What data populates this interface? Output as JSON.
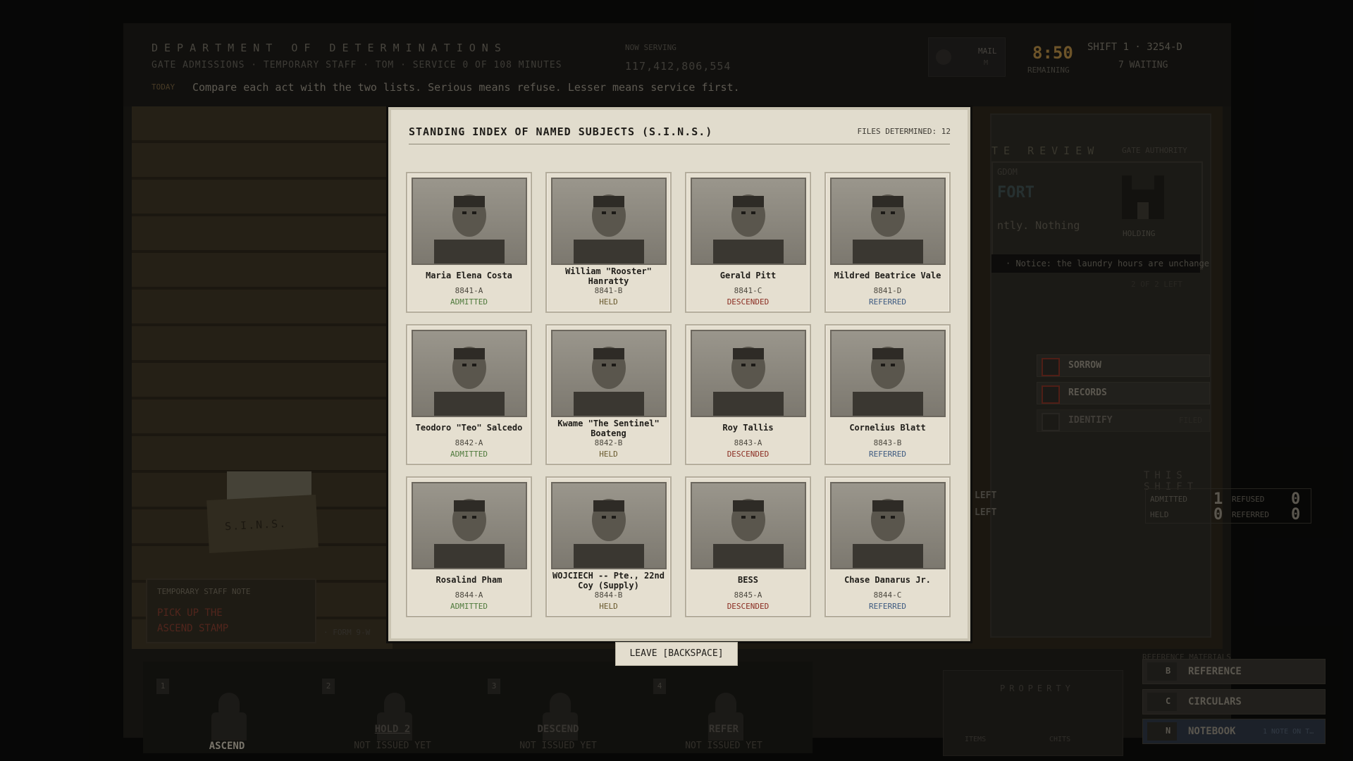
{
  "header": {
    "department": "DEPARTMENT OF DETERMINATIONS",
    "subtitle": "GATE ADMISSIONS · TEMPORARY STAFF · TOM · SERVICE 0 OF 108 MINUTES",
    "today_label": "TODAY",
    "today_text": "Compare each act with the two lists. Serious means refuse. Lesser means service first.",
    "now_serving_label": "NOW SERVING",
    "now_serving_value": "117,412,806,554",
    "mail_label": "MAIL",
    "mail_key": "M",
    "clock": "8:50",
    "remaining_label": "REMAINING",
    "shift": "SHIFT 1 · 3254-D",
    "waiting": "7 WAITING"
  },
  "desk": {
    "sins_label": "S.I.N.S.",
    "note_head": "TEMPORARY STAFF NOTE",
    "note_line1": "PICK UP THE",
    "note_line2": "ASCEND STAMP",
    "form_label": "· FORM 9-W"
  },
  "review": {
    "title": "TE REVIEW",
    "gate_authority": "GATE AUTHORITY",
    "gdom": "GDOM",
    "fort": "FORT",
    "ntly": "ntly. Nothing",
    "holding": "HOLDING",
    "marquee": "· Notice: the laundry hours are unchange",
    "of_left": "2 OF 2 LEFT",
    "buttons": [
      {
        "label": "SORROW",
        "sub": ""
      },
      {
        "label": "RECORDS",
        "sub": ""
      },
      {
        "label": "IDENTIFY",
        "sub": "FILED"
      }
    ],
    "this_shift": "THIS SHIFT",
    "left1": "LEFT",
    "left2": "LEFT",
    "counts": {
      "admitted_label": "ADMITTED",
      "admitted": "1",
      "refused_label": "REFUSED",
      "refused": "0",
      "held_label": "HELD",
      "held": "0",
      "referred_label": "REFERRED",
      "referred": "0"
    }
  },
  "reference": {
    "label": "REFERENCE MATERIALS · DO NOT REMOVE",
    "buttons": [
      {
        "key": "B",
        "label": "REFERENCE",
        "sub": ""
      },
      {
        "key": "C",
        "label": "CIRCULARS",
        "sub": ""
      },
      {
        "key": "N",
        "label": "NOTEBOOK",
        "sub": "1 NOTE ON T…"
      }
    ]
  },
  "stamps": [
    {
      "num": "1",
      "label": "ASCEND",
      "sub": ""
    },
    {
      "num": "2",
      "label": "HOLD 2",
      "sub": "NOT ISSUED YET"
    },
    {
      "num": "3",
      "label": "DESCEND",
      "sub": "NOT ISSUED YET"
    },
    {
      "num": "4",
      "label": "REFER",
      "sub": "NOT ISSUED YET"
    }
  ],
  "property": {
    "label": "PROPERTY",
    "items": "ITEMS",
    "chits": "CHITS"
  },
  "modal": {
    "title": "STANDING INDEX OF NAMED SUBJECTS (S.I.N.S.)",
    "files_determined": "FILES DETERMINED: 12",
    "leave_label": "LEAVE [BACKSPACE]",
    "status_colors": {
      "ADMITTED": "#4f7a3c",
      "HELD": "#6a5a2e",
      "DESCENDED": "#8a2d22",
      "REFERRED": "#3d5a80"
    },
    "subjects": [
      {
        "name": "Maria Elena Costa",
        "id": "8841-A",
        "status": "ADMITTED"
      },
      {
        "name": "William \"Rooster\" Hanratty",
        "id": "8841-B",
        "status": "HELD"
      },
      {
        "name": "Gerald Pitt",
        "id": "8841-C",
        "status": "DESCENDED"
      },
      {
        "name": "Mildred Beatrice Vale",
        "id": "8841-D",
        "status": "REFERRED"
      },
      {
        "name": "Teodoro \"Teo\" Salcedo",
        "id": "8842-A",
        "status": "ADMITTED"
      },
      {
        "name": "Kwame \"The Sentinel\" Boateng",
        "id": "8842-B",
        "status": "HELD"
      },
      {
        "name": "Roy Tallis",
        "id": "8843-A",
        "status": "DESCENDED"
      },
      {
        "name": "Cornelius Blatt",
        "id": "8843-B",
        "status": "REFERRED"
      },
      {
        "name": "Rosalind Pham",
        "id": "8844-A",
        "status": "ADMITTED"
      },
      {
        "name": "WOJCIECH -- Pte., 22nd Coy (Supply)",
        "id": "8844-B",
        "status": "HELD"
      },
      {
        "name": "BESS",
        "id": "8845-A",
        "status": "DESCENDED"
      },
      {
        "name": "Chase Danarus Jr.",
        "id": "8844-C",
        "status": "REFERRED"
      }
    ]
  }
}
